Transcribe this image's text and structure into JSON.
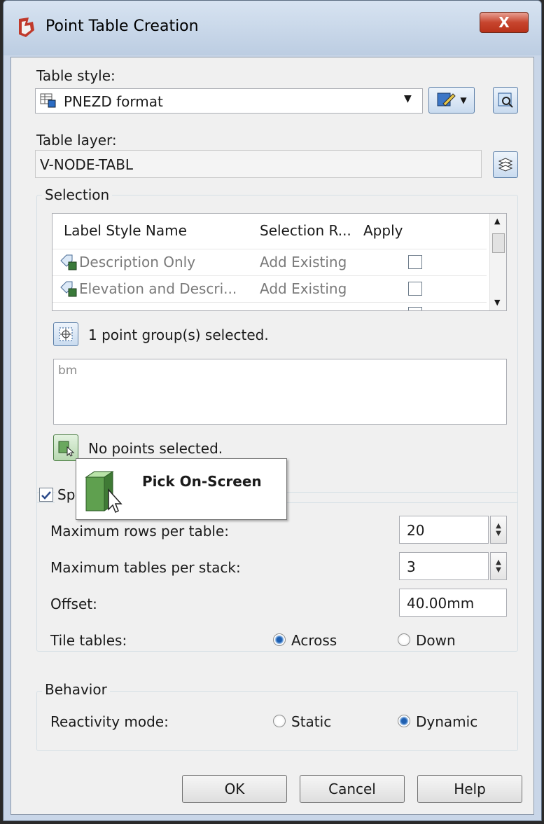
{
  "window": {
    "title": "Point Table Creation",
    "close_label": "X"
  },
  "table_style": {
    "label": "Table style:",
    "value": "PNEZD format"
  },
  "table_layer": {
    "label": "Table layer:",
    "value": "V-NODE-TABL"
  },
  "selection": {
    "label": "Selection",
    "columns": [
      "Label Style Name",
      "Selection R...",
      "Apply"
    ],
    "rows": [
      {
        "name": "Description Only",
        "rule": "Add Existing",
        "apply": false
      },
      {
        "name": "Elevation and Descri...",
        "rule": "Add Existing",
        "apply": false
      }
    ],
    "groups_status": "1 point group(s) selected.",
    "groups_list": [
      "bm"
    ],
    "points_status": "No points selected."
  },
  "tooltip": {
    "text": "Pick On-Screen"
  },
  "split": {
    "label": "Spl",
    "checked": true,
    "max_rows_label": "Maximum rows per table:",
    "max_rows_value": "20",
    "max_tables_label": "Maximum tables per stack:",
    "max_tables_value": "3",
    "offset_label": "Offset:",
    "offset_value": "40.00mm",
    "tile_label": "Tile tables:",
    "across_label": "Across",
    "down_label": "Down",
    "tile_selected": "Across"
  },
  "behavior": {
    "label": "Behavior",
    "mode_label": "Reactivity mode:",
    "static_label": "Static",
    "dynamic_label": "Dynamic",
    "selected": "Dynamic"
  },
  "buttons": {
    "ok": "OK",
    "cancel": "Cancel",
    "help": "Help"
  }
}
